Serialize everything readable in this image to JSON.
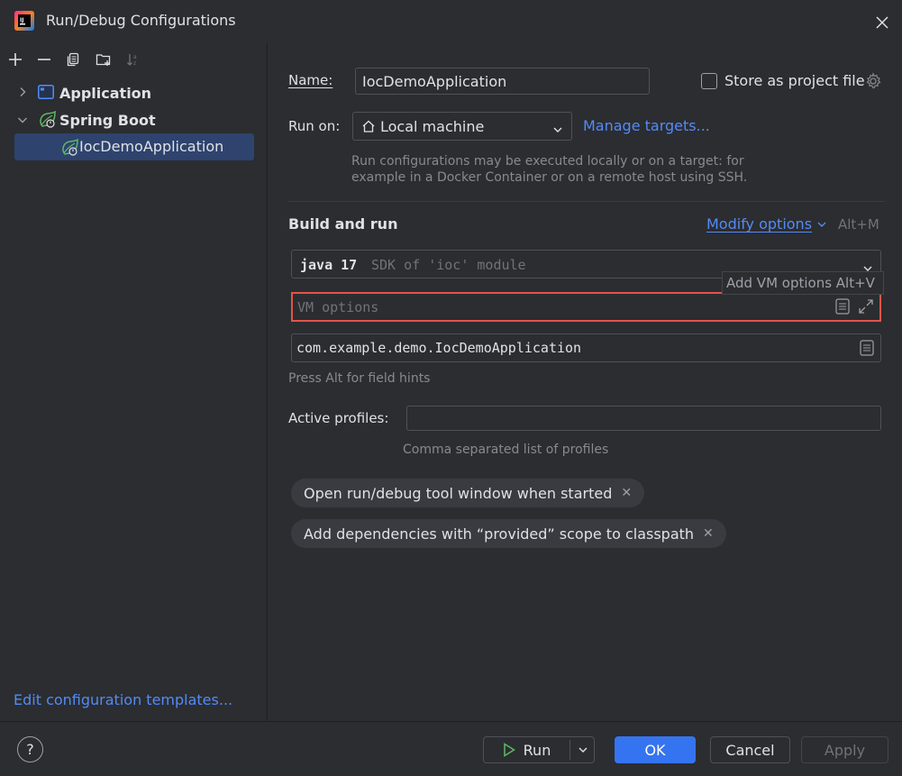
{
  "window": {
    "title": "Run/Debug Configurations"
  },
  "tree": {
    "items": [
      {
        "label": "Application",
        "icon": "application-icon"
      },
      {
        "label": "Spring Boot",
        "icon": "spring-boot-icon"
      },
      {
        "label": "IocDemoApplication",
        "icon": "spring-boot-run-icon"
      }
    ],
    "edit_templates": "Edit configuration templates..."
  },
  "form": {
    "name_label": "Name:",
    "name_value": "IocDemoApplication",
    "store_label": "Store as project file",
    "run_on_label": "Run on:",
    "run_on_value": "Local machine",
    "manage_targets": "Manage targets...",
    "run_on_hint_1": "Run configurations may be executed locally or on a target: for",
    "run_on_hint_2": "example in a Docker Container or on a remote host using SSH.",
    "build_run_title": "Build and run",
    "modify_options": "Modify options",
    "modify_shortcut": "Alt+M",
    "jdk_strong": "java 17",
    "jdk_detail": "SDK of 'ioc' module",
    "vm_placeholder": "VM options",
    "tooltip": "Add VM options Alt+V",
    "main_class": "com.example.demo.IocDemoApplication",
    "field_hint": "Press Alt for field hints",
    "active_profiles_label": "Active profiles:",
    "active_profiles_value": "",
    "profiles_hint": "Comma separated list of profiles",
    "chips": [
      "Open run/debug tool window when started",
      "Add dependencies with “provided” scope to classpath"
    ]
  },
  "buttons": {
    "help": "?",
    "run": "Run",
    "ok": "OK",
    "cancel": "Cancel",
    "apply": "Apply"
  },
  "colors": {
    "background": "#2b2d30",
    "accent": "#3574f0",
    "link": "#548af7",
    "selection": "#2e436e",
    "error_border": "#e5534b"
  }
}
